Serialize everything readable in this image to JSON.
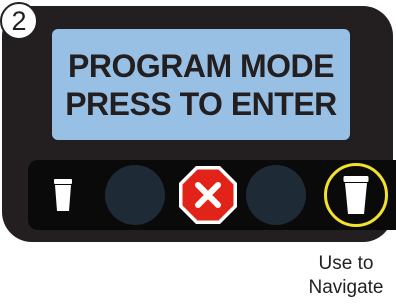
{
  "step": {
    "number": "2"
  },
  "display": {
    "line1": "PROGRAM MODE",
    "line2": "PRESS TO ENTER",
    "background_color": "#98c0e4"
  },
  "buttons": {
    "small_cup": {
      "icon": "small-cup-icon"
    },
    "left": {
      "icon": "none"
    },
    "cancel": {
      "icon": "cancel-x-icon",
      "color": "#e2231a"
    },
    "right": {
      "icon": "none"
    },
    "large_cup": {
      "icon": "large-cup-icon",
      "highlight_color": "#f3e12b"
    }
  },
  "caption": {
    "line1": "Use to",
    "line2": "Navigate"
  }
}
